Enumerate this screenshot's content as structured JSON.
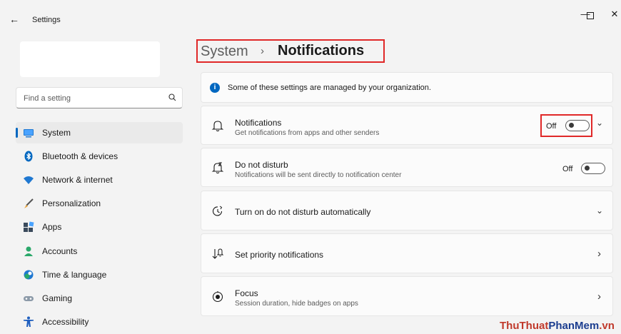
{
  "window": {
    "app_title": "Settings",
    "minimize_glyph": "—",
    "close_glyph": "✕",
    "back_glyph": "←"
  },
  "search": {
    "placeholder": "Find a setting"
  },
  "sidebar": {
    "items": [
      {
        "label": "System",
        "icon": "system-icon",
        "selected": true
      },
      {
        "label": "Bluetooth & devices",
        "icon": "bluetooth-icon"
      },
      {
        "label": "Network & internet",
        "icon": "wifi-icon"
      },
      {
        "label": "Personalization",
        "icon": "brush-icon"
      },
      {
        "label": "Apps",
        "icon": "apps-icon"
      },
      {
        "label": "Accounts",
        "icon": "accounts-icon"
      },
      {
        "label": "Time & language",
        "icon": "globe-clock-icon"
      },
      {
        "label": "Gaming",
        "icon": "gamepad-icon"
      },
      {
        "label": "Accessibility",
        "icon": "accessibility-icon"
      }
    ]
  },
  "header": {
    "parent": "System",
    "separator": "›",
    "current": "Notifications"
  },
  "info_banner": {
    "icon_glyph": "i",
    "text": "Some of these settings are managed by your organization."
  },
  "settings": [
    {
      "title": "Notifications",
      "description": "Get notifications from apps and other senders",
      "icon": "bell-icon",
      "toggle": "Off",
      "chevron": "⌄"
    },
    {
      "title": "Do not disturb",
      "description": "Notifications will be sent directly to notification center",
      "icon": "bell-snooze-icon",
      "toggle": "Off"
    },
    {
      "title": "Turn on do not disturb automatically",
      "icon": "clock-icon",
      "chevron": "⌄"
    },
    {
      "title": "Set priority notifications",
      "icon": "priority-icon",
      "chevron": "›"
    },
    {
      "title": "Focus",
      "description": "Session duration, hide badges on apps",
      "icon": "focus-icon",
      "chevron": "›"
    }
  ],
  "watermark": {
    "part1": "ThuThuat",
    "part2": "PhanMem",
    "part3": ".vn"
  },
  "colors": {
    "accent": "#0067c0",
    "highlight_box": "#e02828",
    "window_bg": "#f3f3f3",
    "card_bg": "#fbfbfb"
  }
}
